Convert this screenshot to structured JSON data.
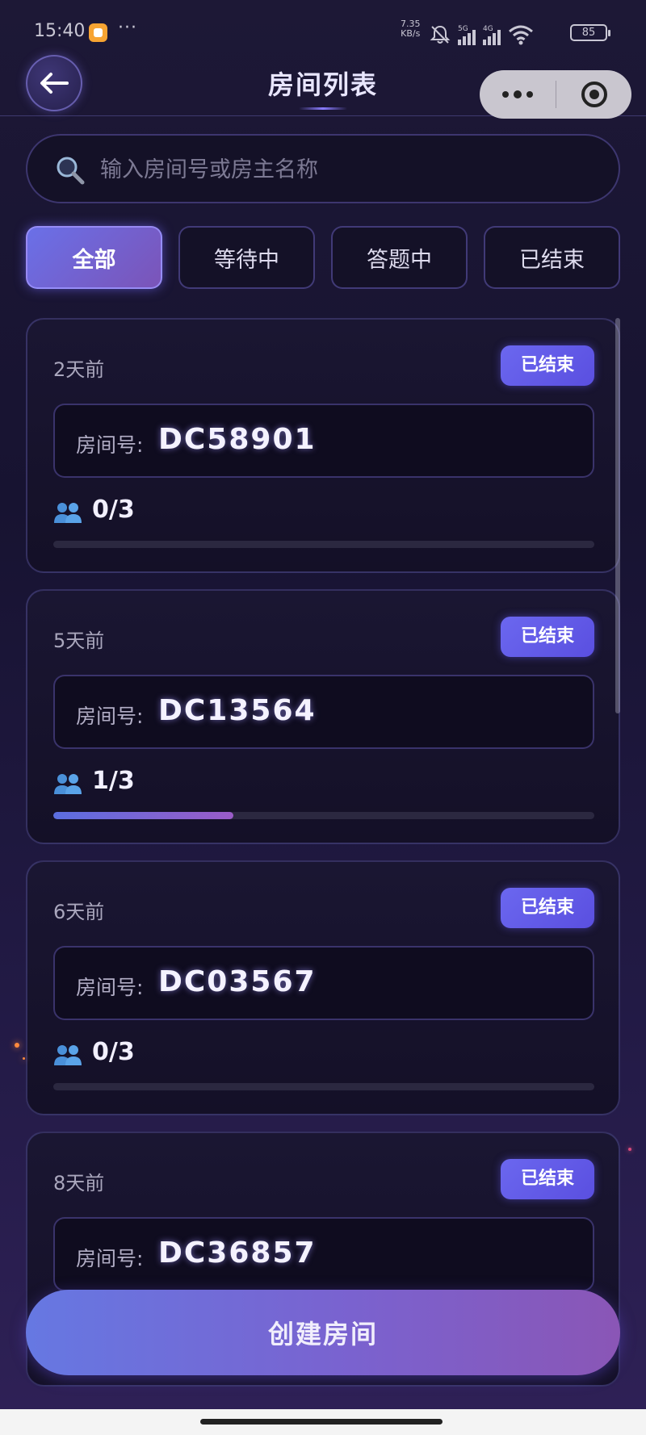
{
  "status_bar": {
    "time": "15:40",
    "dots": "···",
    "speed_value": "7.35",
    "speed_unit": "KB/s",
    "signal_1_label": "5G",
    "signal_2_label": "4G",
    "battery": "85"
  },
  "nav": {
    "title": "房间列表"
  },
  "search": {
    "placeholder": "输入房间号或房主名称",
    "value": ""
  },
  "tabs": [
    {
      "label": "全部",
      "active": true
    },
    {
      "label": "等待中",
      "active": false
    },
    {
      "label": "答题中",
      "active": false
    },
    {
      "label": "已结束",
      "active": false
    }
  ],
  "rooms": [
    {
      "time": "2天前",
      "status": "已结束",
      "room_label": "房间号:",
      "room_code": "DC58901",
      "players": "0/3",
      "fill": 0
    },
    {
      "time": "5天前",
      "status": "已结束",
      "room_label": "房间号:",
      "room_code": "DC13564",
      "players": "1/3",
      "fill": 0.333
    },
    {
      "time": "6天前",
      "status": "已结束",
      "room_label": "房间号:",
      "room_code": "DC03567",
      "players": "0/3",
      "fill": 0
    },
    {
      "time": "8天前",
      "status": "已结束",
      "room_label": "房间号:",
      "room_code": "DC36857",
      "players": "",
      "fill": 0
    }
  ],
  "create_button": {
    "label": "创建房间"
  },
  "colors": {
    "accent": "#6b67ef",
    "background": "#171331",
    "progress_fill": "#7a62cf"
  }
}
